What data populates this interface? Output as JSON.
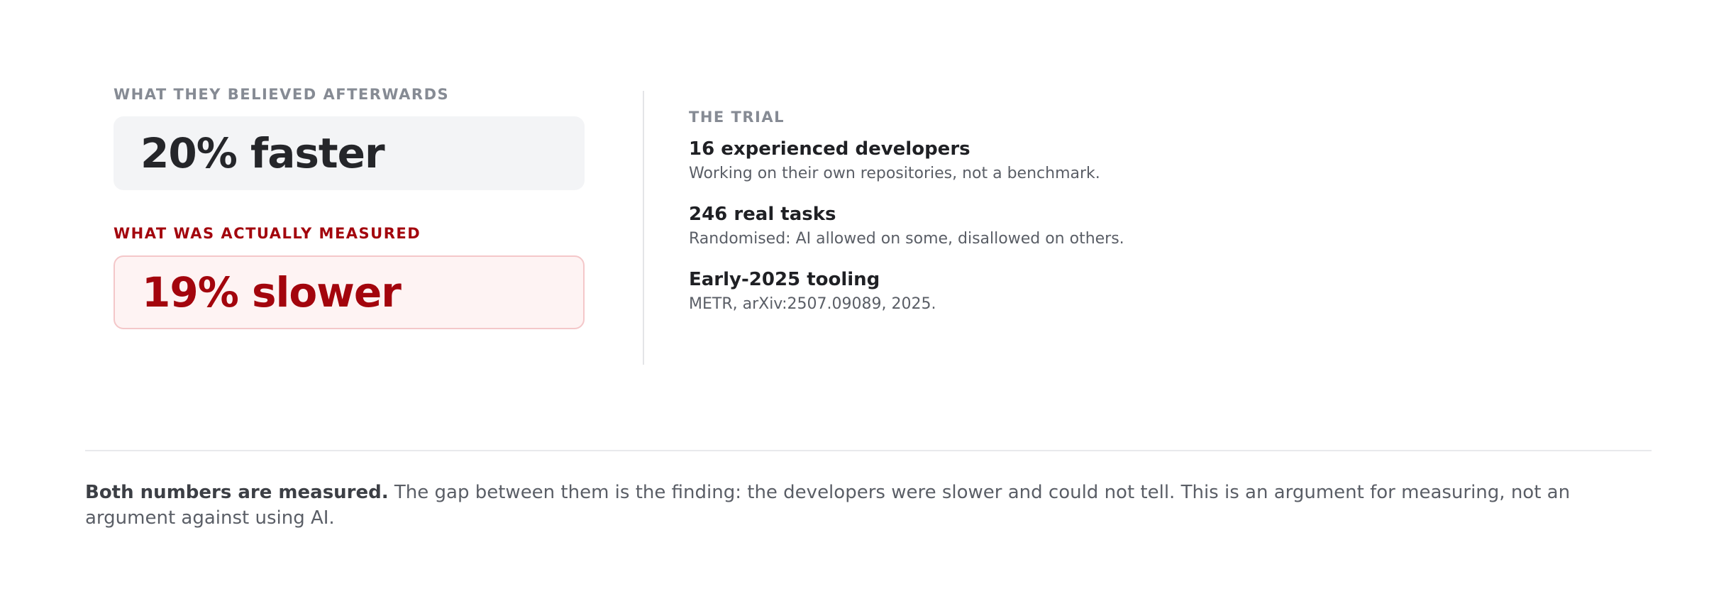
{
  "believed": {
    "label": "WHAT THEY BELIEVED AFTERWARDS",
    "value": "20% faster"
  },
  "measured": {
    "label": "WHAT WAS ACTUALLY MEASURED",
    "value": "19% slower"
  },
  "trial": {
    "title": "THE TRIAL",
    "items": [
      {
        "heading": "16 experienced developers",
        "detail": "Working on their own repositories, not a benchmark."
      },
      {
        "heading": "246 real tasks",
        "detail": "Randomised: AI allowed on some, disallowed on others."
      },
      {
        "heading": "Early-2025 tooling",
        "detail": "METR, arXiv:2507.09089, 2025."
      }
    ]
  },
  "footnote": {
    "lead": "Both numbers are measured.",
    "body": " The gap between them is the finding: the developers were slower and could not tell. This is an argument for measuring, not an argument against using AI."
  },
  "colors": {
    "accent_red": "#a3050d",
    "muted_gray": "#868b94",
    "box_gray": "#f3f4f6",
    "box_red": "#fef3f3"
  }
}
